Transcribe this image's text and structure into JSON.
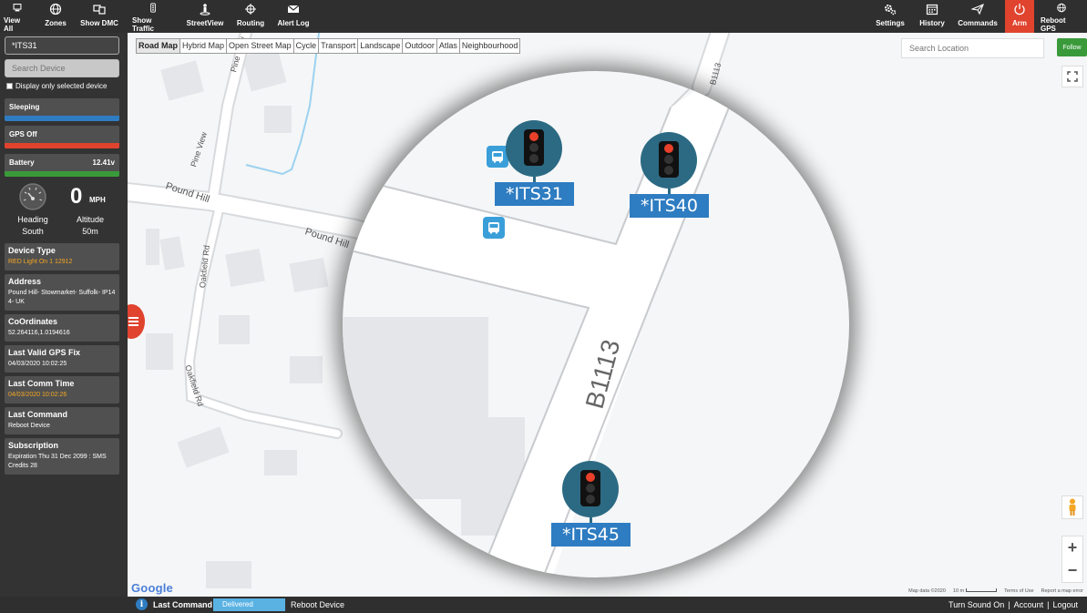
{
  "toolbar": {
    "left": [
      {
        "label": "View All",
        "icon": "view-all-icon"
      },
      {
        "label": "Zones",
        "icon": "globe-icon"
      },
      {
        "label": "Show DMC",
        "icon": "devices-icon"
      },
      {
        "label": "Show Traffic",
        "icon": "traffic-light-icon"
      },
      {
        "label": "StreetView",
        "icon": "street-view-icon"
      },
      {
        "label": "Routing",
        "icon": "routing-icon"
      },
      {
        "label": "Alert Log",
        "icon": "envelope-icon"
      }
    ],
    "right": [
      {
        "label": "Settings",
        "icon": "gears-icon"
      },
      {
        "label": "History",
        "icon": "calendar-icon"
      },
      {
        "label": "Commands",
        "icon": "paper-plane-icon"
      },
      {
        "label": "Arm",
        "icon": "power-icon"
      },
      {
        "label": "Reboot GPS",
        "icon": "globe-icon"
      }
    ],
    "arm_color": "#e0432e"
  },
  "sidebar": {
    "selected_device": "*ITS31",
    "search_placeholder": "Search Device",
    "only_selected_label": "Display only selected device",
    "statuses": {
      "sleeping": {
        "label": "Sleeping",
        "color": "#2e7cc1"
      },
      "gps": {
        "label": "GPS Off",
        "color": "#e0432e"
      },
      "battery": {
        "label": "Battery",
        "value": "12.41v",
        "color": "#3a9a3a"
      }
    },
    "speed": {
      "value": "0",
      "unit": "MPH"
    },
    "heading": {
      "label": "Heading",
      "value": "South"
    },
    "altitude": {
      "label": "Altitude",
      "value": "50m"
    },
    "cards": {
      "device_type": {
        "title": "Device Type",
        "value": "RED Light On 1 12912"
      },
      "address": {
        "title": "Address",
        "value": "Pound Hill- Stowmarket- Suffolk- IP14 4- UK"
      },
      "coordinates": {
        "title": "CoOrdinates",
        "value": "52.264116,1.0194616"
      },
      "last_gps_fix": {
        "title": "Last Valid GPS Fix",
        "value": "04/03/2020 10:02:25"
      },
      "last_comm": {
        "title": "Last Comm Time",
        "value": "04/03/2020 10:02:26"
      },
      "last_command": {
        "title": "Last Command",
        "value": "Reboot Device"
      },
      "subscription": {
        "title": "Subscription",
        "value": "Expiration Thu 31 Dec 2099 : SMS Credits 28"
      }
    }
  },
  "map": {
    "types": [
      "Road Map",
      "Hybrid Map",
      "Open Street Map",
      "Cycle",
      "Transport",
      "Landscape",
      "Outdoor",
      "Atlas",
      "Neighbourhood"
    ],
    "active_type": "Road Map",
    "search_placeholder": "Search Location",
    "follow_label": "Follow",
    "labels": {
      "pine_view_1": "Pine View",
      "pine_view_2": "Pine View",
      "pound_hill_1": "Pound Hill",
      "pound_hill_2": "Pound Hill",
      "oakfield_1": "Oakfield Rd",
      "oakfield_2": "Oakfield Rd",
      "b1113_top": "B1113",
      "b1113_mag": "B1113"
    },
    "devices": [
      "*ITS31",
      "*ITS40",
      "*ITS45"
    ],
    "google": "Google",
    "footer": {
      "map_data": "Map data ©2020",
      "scale": "10 m",
      "terms": "Terms of Use",
      "report": "Report a map error"
    },
    "zoom_in": "+",
    "zoom_out": "−"
  },
  "bottom": {
    "last_command_label": "Last Command",
    "status": "Delivered",
    "command": "Reboot Device",
    "links": [
      "Turn Sound On",
      "|",
      "Account",
      "|",
      "Logout"
    ]
  }
}
